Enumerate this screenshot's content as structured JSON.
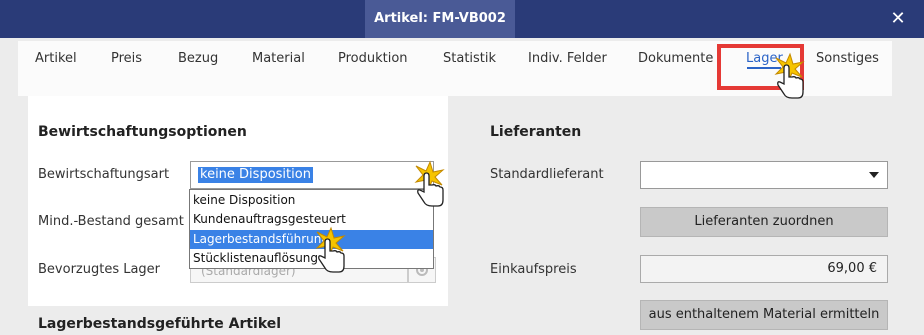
{
  "window": {
    "title": "Artikel: FM-VB002",
    "close_glyph": "✕"
  },
  "tabs": [
    {
      "label": "Artikel",
      "active": false
    },
    {
      "label": "Preis",
      "active": false
    },
    {
      "label": "Bezug",
      "active": false
    },
    {
      "label": "Material",
      "active": false
    },
    {
      "label": "Produktion",
      "active": false
    },
    {
      "label": "Statistik",
      "active": false
    },
    {
      "label": "Indiv. Felder",
      "active": false
    },
    {
      "label": "Dokumente",
      "active": false
    },
    {
      "label": "Lager",
      "active": true
    },
    {
      "label": "Sonstiges",
      "active": false
    }
  ],
  "left": {
    "section_title": "Bewirtschaftungsoptionen",
    "art_label": "Bewirtschaftungsart",
    "art_value": "keine Disposition",
    "mind_label": "Mind.-Bestand gesamt",
    "lager_label": "Bevorzugtes Lager",
    "lager_value": "(Standardlager)",
    "dropdown_options": [
      {
        "label": "keine Disposition",
        "selected": false
      },
      {
        "label": "Kundenauftragsgesteuert",
        "selected": false
      },
      {
        "label": "Lagerbestandsführung",
        "selected": true
      },
      {
        "label": "Stücklistenauflösung",
        "selected": false
      }
    ],
    "bottom_title": "Lagerbestandsgeführte Artikel"
  },
  "right": {
    "section_title": "Lieferanten",
    "std_label": "Standardlieferant",
    "std_value": "",
    "assign_button": "Lieferanten zuordnen",
    "price_label": "Einkaufspreis",
    "price_value": "69,00 €",
    "material_button": "aus enthaltenem Material ermitteln"
  },
  "colors": {
    "titlebar": "#2a3b78",
    "accent": "#2a63c7",
    "highlight": "#e53935",
    "selection": "#3a82e6"
  }
}
